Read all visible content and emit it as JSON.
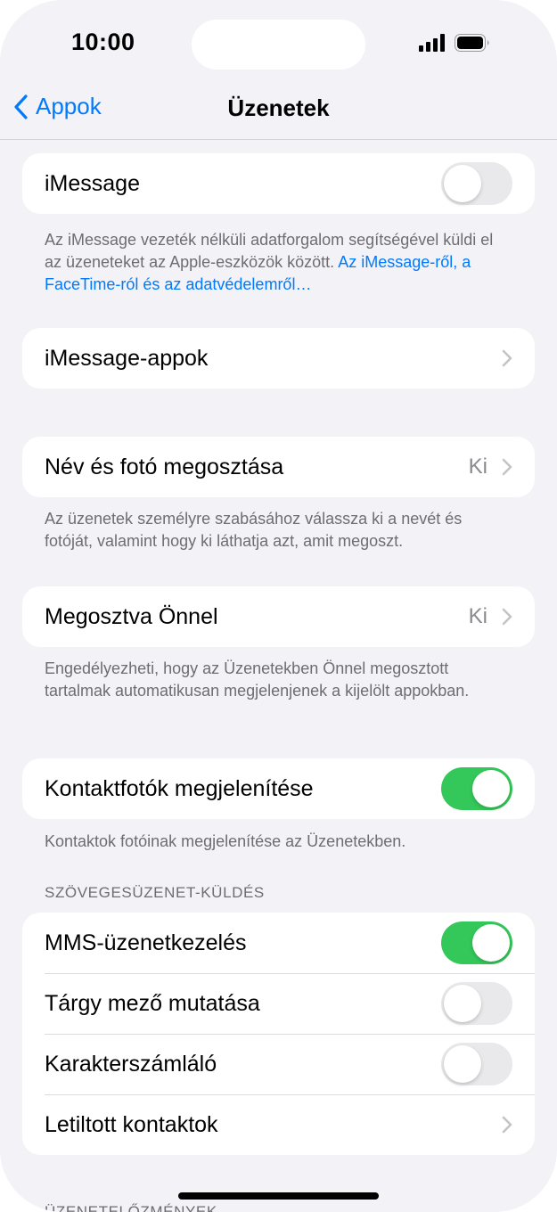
{
  "status": {
    "time": "10:00"
  },
  "nav": {
    "back_label": "Appok",
    "title": "Üzenetek"
  },
  "imessage": {
    "label": "iMessage",
    "enabled": false,
    "footnote_text": "Az iMessage vezeték nélküli adatforgalom segítségével küldi el az üzeneteket az Apple-eszközök között. ",
    "footnote_link": "Az iMessage-ről, a FaceTime-ról és az adatvédelemről…"
  },
  "imessage_apps": {
    "label": "iMessage-appok"
  },
  "name_photo": {
    "label": "Név és fotó megosztása",
    "value": "Ki",
    "footnote": "Az üzenetek személyre szabásához válassza ki a nevét és fotóját, valamint hogy ki láthatja azt, amit megoszt."
  },
  "shared_with_you": {
    "label": "Megosztva Önnel",
    "value": "Ki",
    "footnote": "Engedélyezheti, hogy az Üzenetekben Önnel megosztott tartalmak automatikusan megjelenjenek a kijelölt appokban."
  },
  "contact_photos": {
    "label": "Kontaktfotók megjelenítése",
    "enabled": true,
    "footnote": "Kontaktok fotóinak megjelenítése az Üzenetekben."
  },
  "sms_section": {
    "header": "SZÖVEGESÜZENET-KÜLDÉS",
    "rows": [
      {
        "label": "MMS-üzenetkezelés",
        "enabled": true
      },
      {
        "label": "Tárgy mező mutatása",
        "enabled": false
      },
      {
        "label": "Karakterszámláló",
        "enabled": false
      },
      {
        "label": "Letiltott kontaktok"
      }
    ]
  },
  "history_section": {
    "header": "ÜZENETELŐZMÉNYEK"
  },
  "colors": {
    "accent": "#007aff",
    "toggle_on": "#34c759",
    "toggle_off": "#e9e9eb",
    "background": "#f2f2f7"
  }
}
